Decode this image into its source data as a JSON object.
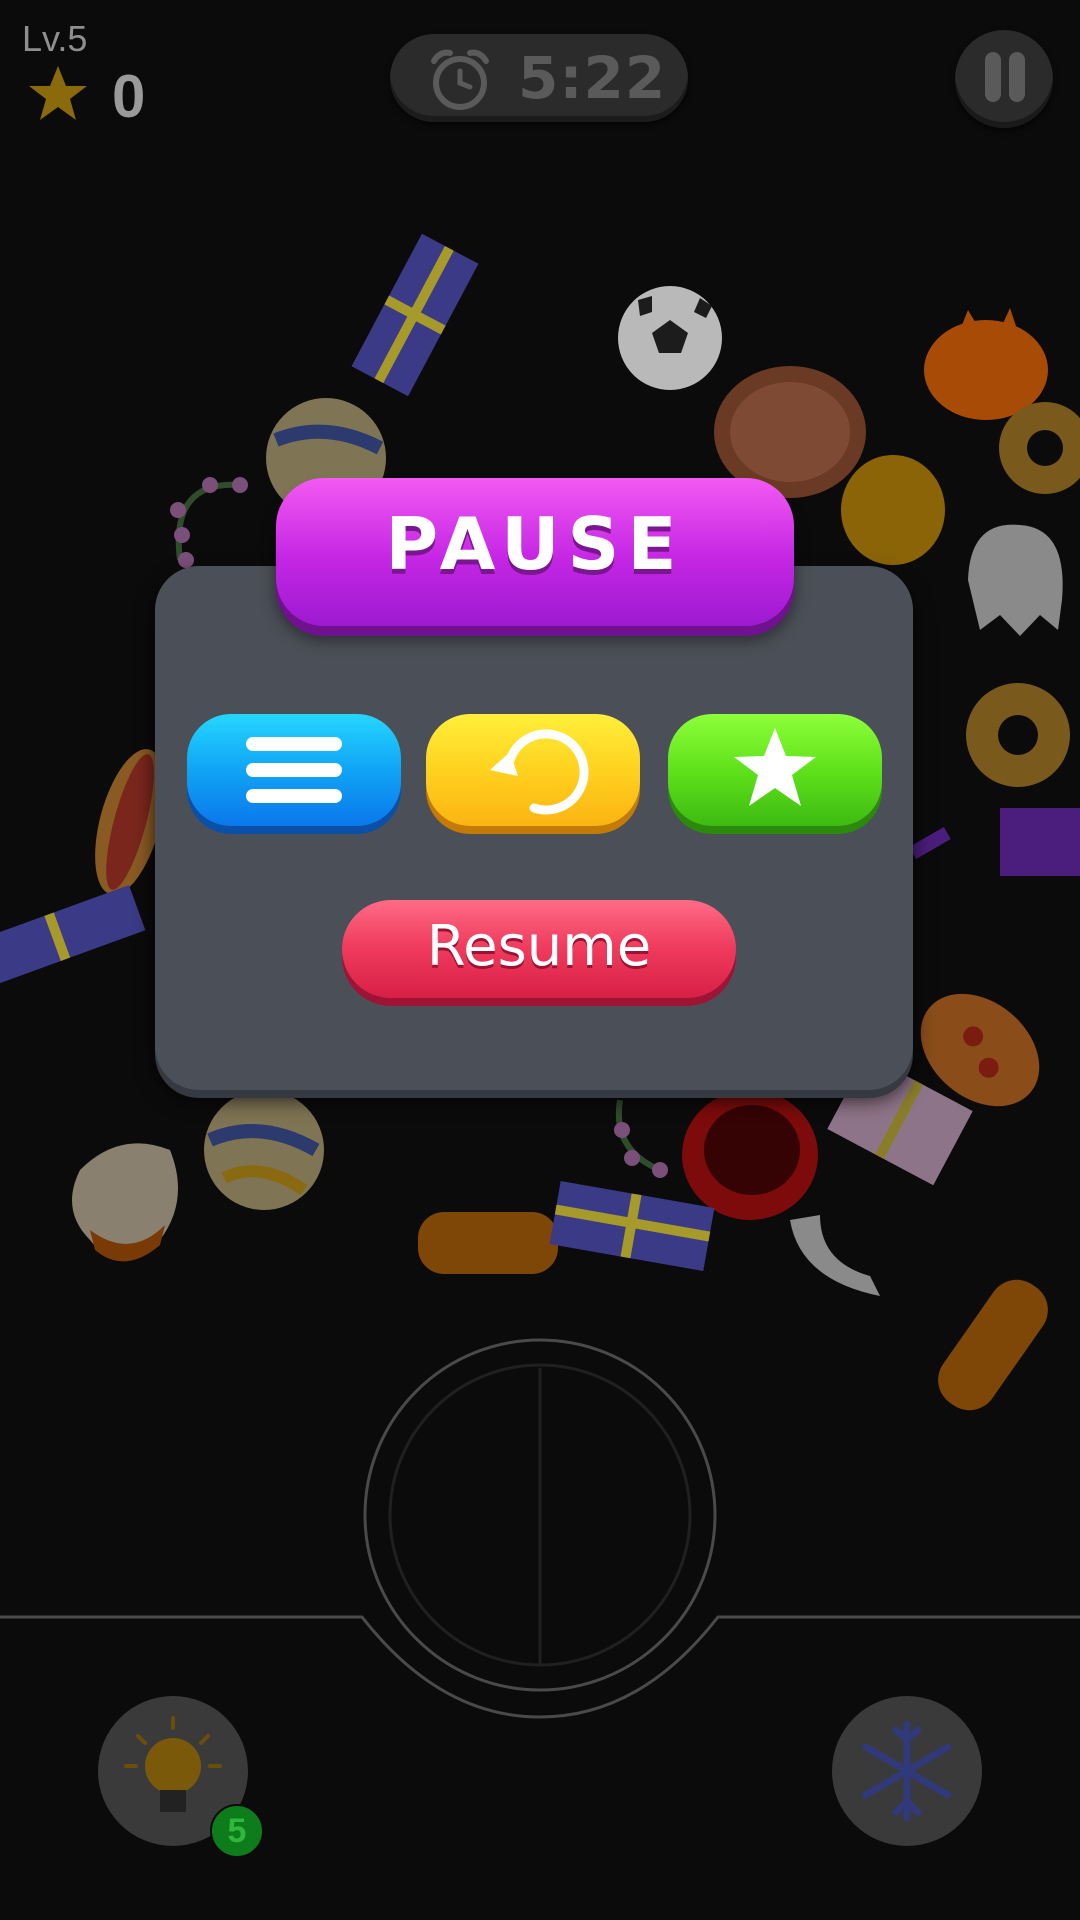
{
  "hud": {
    "level": "Lv.5",
    "score": "0",
    "timer": "5:22"
  },
  "dialog": {
    "title": "PAUSE",
    "menu_button_icon": "menu-lines-icon",
    "restart_button_icon": "restart-arrow-icon",
    "rate_button_icon": "star-icon",
    "resume_label": "Resume"
  },
  "boosters": {
    "hint_count": "5",
    "hint_icon": "lightbulb-icon",
    "freeze_icon": "snowflake-icon"
  },
  "colors": {
    "title_pill": "#c426e4",
    "panel": "#4b4f57",
    "menu_button": "#10a4f5",
    "restart_button": "#ffd21f",
    "rate_button": "#5fe21a",
    "resume_button": "#ef3a5c"
  }
}
